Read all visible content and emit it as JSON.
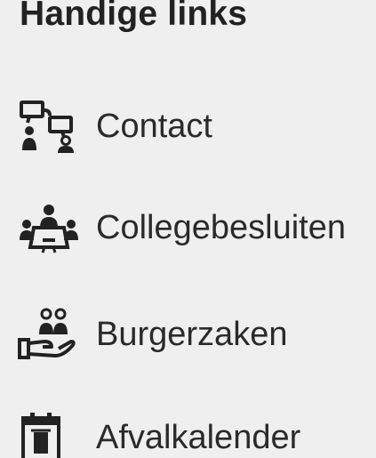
{
  "section": {
    "title": "Handige links"
  },
  "links": [
    {
      "label": "Contact",
      "icon": "contact-people-chat-icon"
    },
    {
      "label": "Collegebesluiten",
      "icon": "council-meeting-icon"
    },
    {
      "label": "Burgerzaken",
      "icon": "civil-affairs-hand-icon"
    },
    {
      "label": "Afvalkalender",
      "icon": "waste-calendar-icon"
    }
  ],
  "colors": {
    "background": "#efefef",
    "text": "#222222"
  }
}
